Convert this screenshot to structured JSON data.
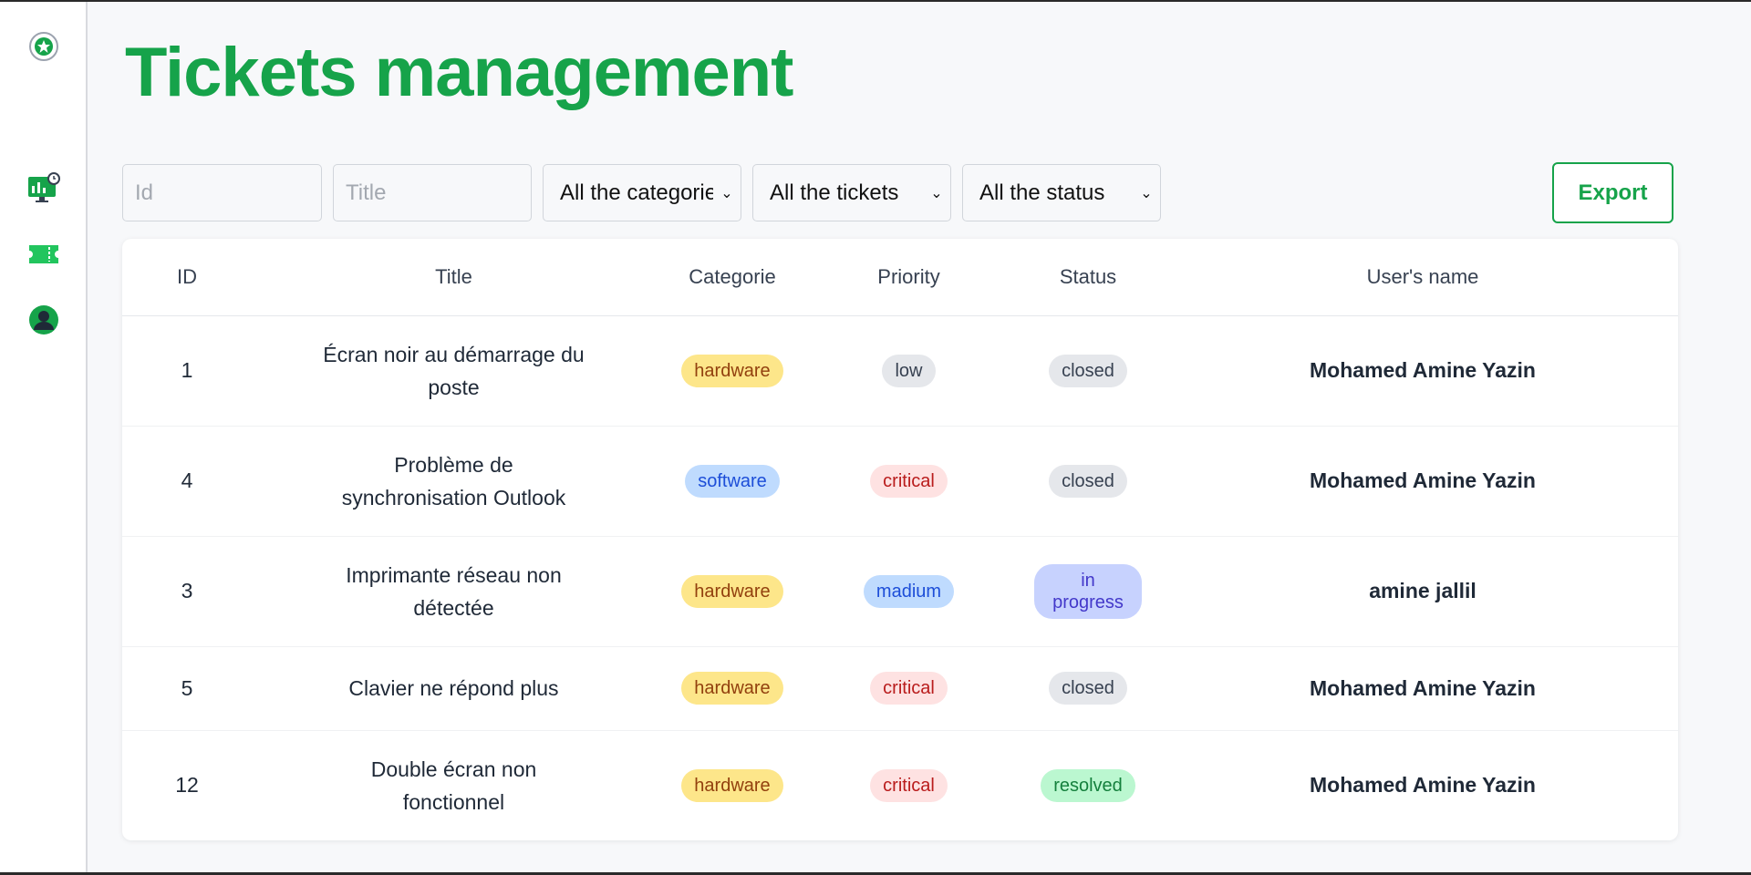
{
  "sidebar": {
    "logo_icon": "emblem-icon",
    "items": [
      {
        "icon": "dashboard-monitor-icon",
        "label": "Dashboard"
      },
      {
        "icon": "ticket-icon",
        "label": "Tickets"
      },
      {
        "icon": "user-profile-icon",
        "label": "Profile"
      }
    ],
    "accent_color": "#16a34a"
  },
  "page": {
    "title": "Tickets management"
  },
  "filters": {
    "id_placeholder": "Id",
    "title_placeholder": "Title",
    "category_value": "All the categories",
    "tickets_value": "All the tickets",
    "status_value": "All the status"
  },
  "toolbar": {
    "export_label": "Export"
  },
  "table": {
    "headers": [
      "ID",
      "Title",
      "Categorie",
      "Priority",
      "Status",
      "User's name"
    ],
    "rows": [
      {
        "id": "1",
        "title": "Écran noir au démarrage du poste",
        "category": "hardware",
        "priority": "low",
        "status": "closed",
        "user": "Mohamed Amine Yazin"
      },
      {
        "id": "4",
        "title": "Problème de synchronisation Outlook",
        "category": "software",
        "priority": "critical",
        "status": "closed",
        "user": "Mohamed Amine Yazin"
      },
      {
        "id": "3",
        "title": "Imprimante réseau non détectée",
        "category": "hardware",
        "priority": "madium",
        "status": "in progress",
        "user": "amine jallil"
      },
      {
        "id": "5",
        "title": "Clavier ne répond plus",
        "category": "hardware",
        "priority": "critical",
        "status": "closed",
        "user": "Mohamed Amine Yazin"
      },
      {
        "id": "12",
        "title": "Double écran non fonctionnel",
        "category": "hardware",
        "priority": "critical",
        "status": "resolved",
        "user": "Mohamed Amine Yazin"
      }
    ]
  },
  "colors": {
    "hardware": "#fde68a",
    "software": "#bfdbfe",
    "critical": "#fee2e2",
    "closed": "#e5e7eb",
    "in_progress": "#c7d2fe",
    "resolved": "#bbf7d0"
  }
}
